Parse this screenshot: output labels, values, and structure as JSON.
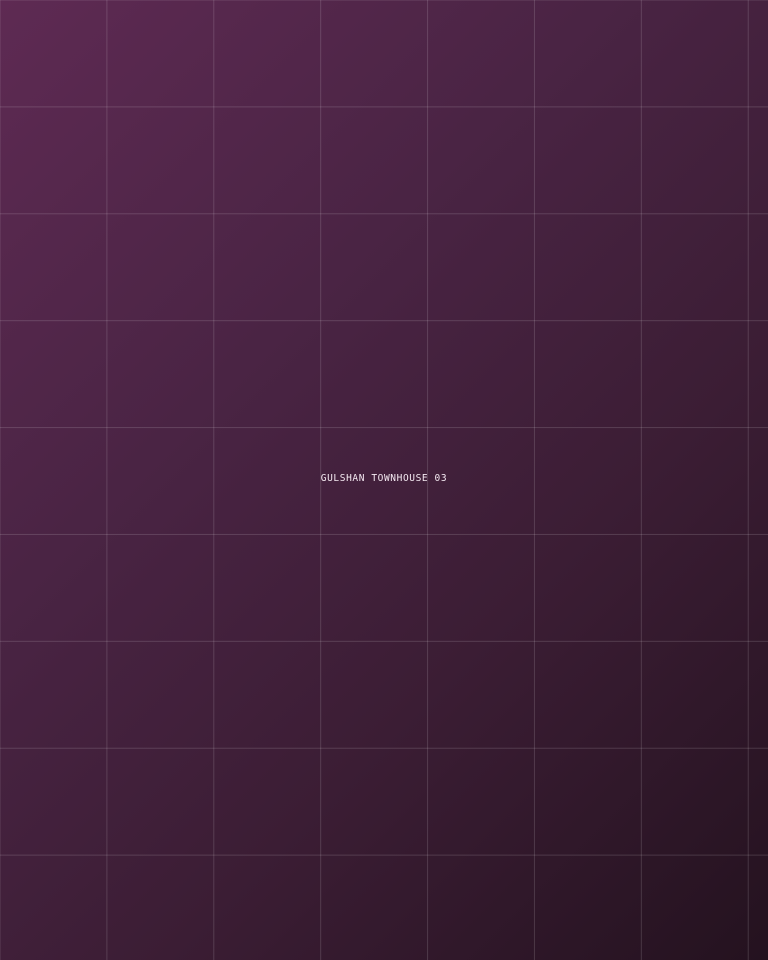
{
  "caption": "GULSHAN TOWNHOUSE 03",
  "colors": {
    "background_top_left": "#5e2a53",
    "background_bottom_right": "#24121f",
    "grid_line": "rgba(255,255,255,0.14)",
    "caption_text": "#f4e9f1"
  }
}
